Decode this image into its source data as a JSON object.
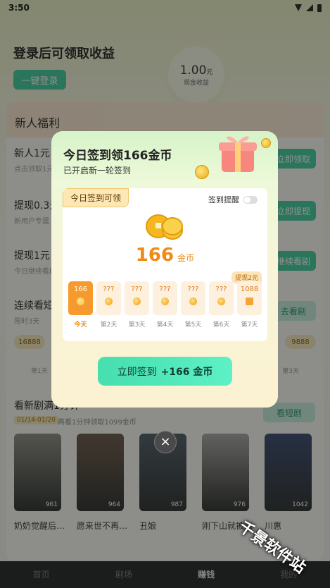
{
  "status": {
    "time": "3:50"
  },
  "header": {
    "title": "登录后可领取收益",
    "login_button": "一键登录",
    "cash_amount": "1.00",
    "cash_unit": "元",
    "cash_label": "现金收益"
  },
  "welfare": {
    "title": "新人福利",
    "tasks": [
      {
        "title": "新人1元",
        "sub": "点击领取1元",
        "button": "立即领取"
      },
      {
        "title": "提现0.3元",
        "sub": "新用户专属",
        "button": "立即提现"
      },
      {
        "title": "提现1元",
        "sub": "今日继续看剧",
        "button": "继续看剧"
      },
      {
        "title": "连续看短剧",
        "sub": "限时3天",
        "button": "去看剧"
      }
    ],
    "pill_left": "16888",
    "pill_right": "9888",
    "day_left": "第1天",
    "day_right": "第3天"
  },
  "new_show": {
    "title": "看新剧满1分钟",
    "date_tag": "01/14-01/20",
    "sub": "再看1分钟领取1099金币",
    "button": "看短剧",
    "posters": [
      {
        "title": "奶奶觉醒后…",
        "views": "961",
        "color": "#8c8a82"
      },
      {
        "title": "愿来世不再…",
        "views": "964",
        "color": "#6b5648"
      },
      {
        "title": "丑娘",
        "views": "987",
        "color": "#4e5a66"
      },
      {
        "title": "刚下山就被…",
        "views": "976",
        "color": "#a7a3a5"
      },
      {
        "title": "川惠",
        "views": "1042",
        "color": "#39466e"
      }
    ]
  },
  "tabbar": {
    "tabs": [
      "首页",
      "剧场",
      "赚钱",
      "我的"
    ],
    "active": 2
  },
  "modal": {
    "title": "今日签到领166金币",
    "subtitle": "已开启新一轮签到",
    "today_tag": "今日签到可领",
    "reminder": "签到提醒",
    "coin_amount": "166",
    "coin_unit": "金币",
    "withdraw_tag": "提现2元",
    "days": [
      {
        "value": "166",
        "label": "今天"
      },
      {
        "value": "???",
        "label": "第2天"
      },
      {
        "value": "???",
        "label": "第3天"
      },
      {
        "value": "???",
        "label": "第4天"
      },
      {
        "value": "???",
        "label": "第5天"
      },
      {
        "value": "???",
        "label": "第6天"
      },
      {
        "value": "1088",
        "label": "第7天"
      }
    ],
    "signin_prefix": "立即签到",
    "signin_amount": "+166 金币",
    "close": "×"
  },
  "watermark": "千景软件站",
  "colors": {
    "accent": "#3fc99c",
    "coin": "#f08a12"
  }
}
